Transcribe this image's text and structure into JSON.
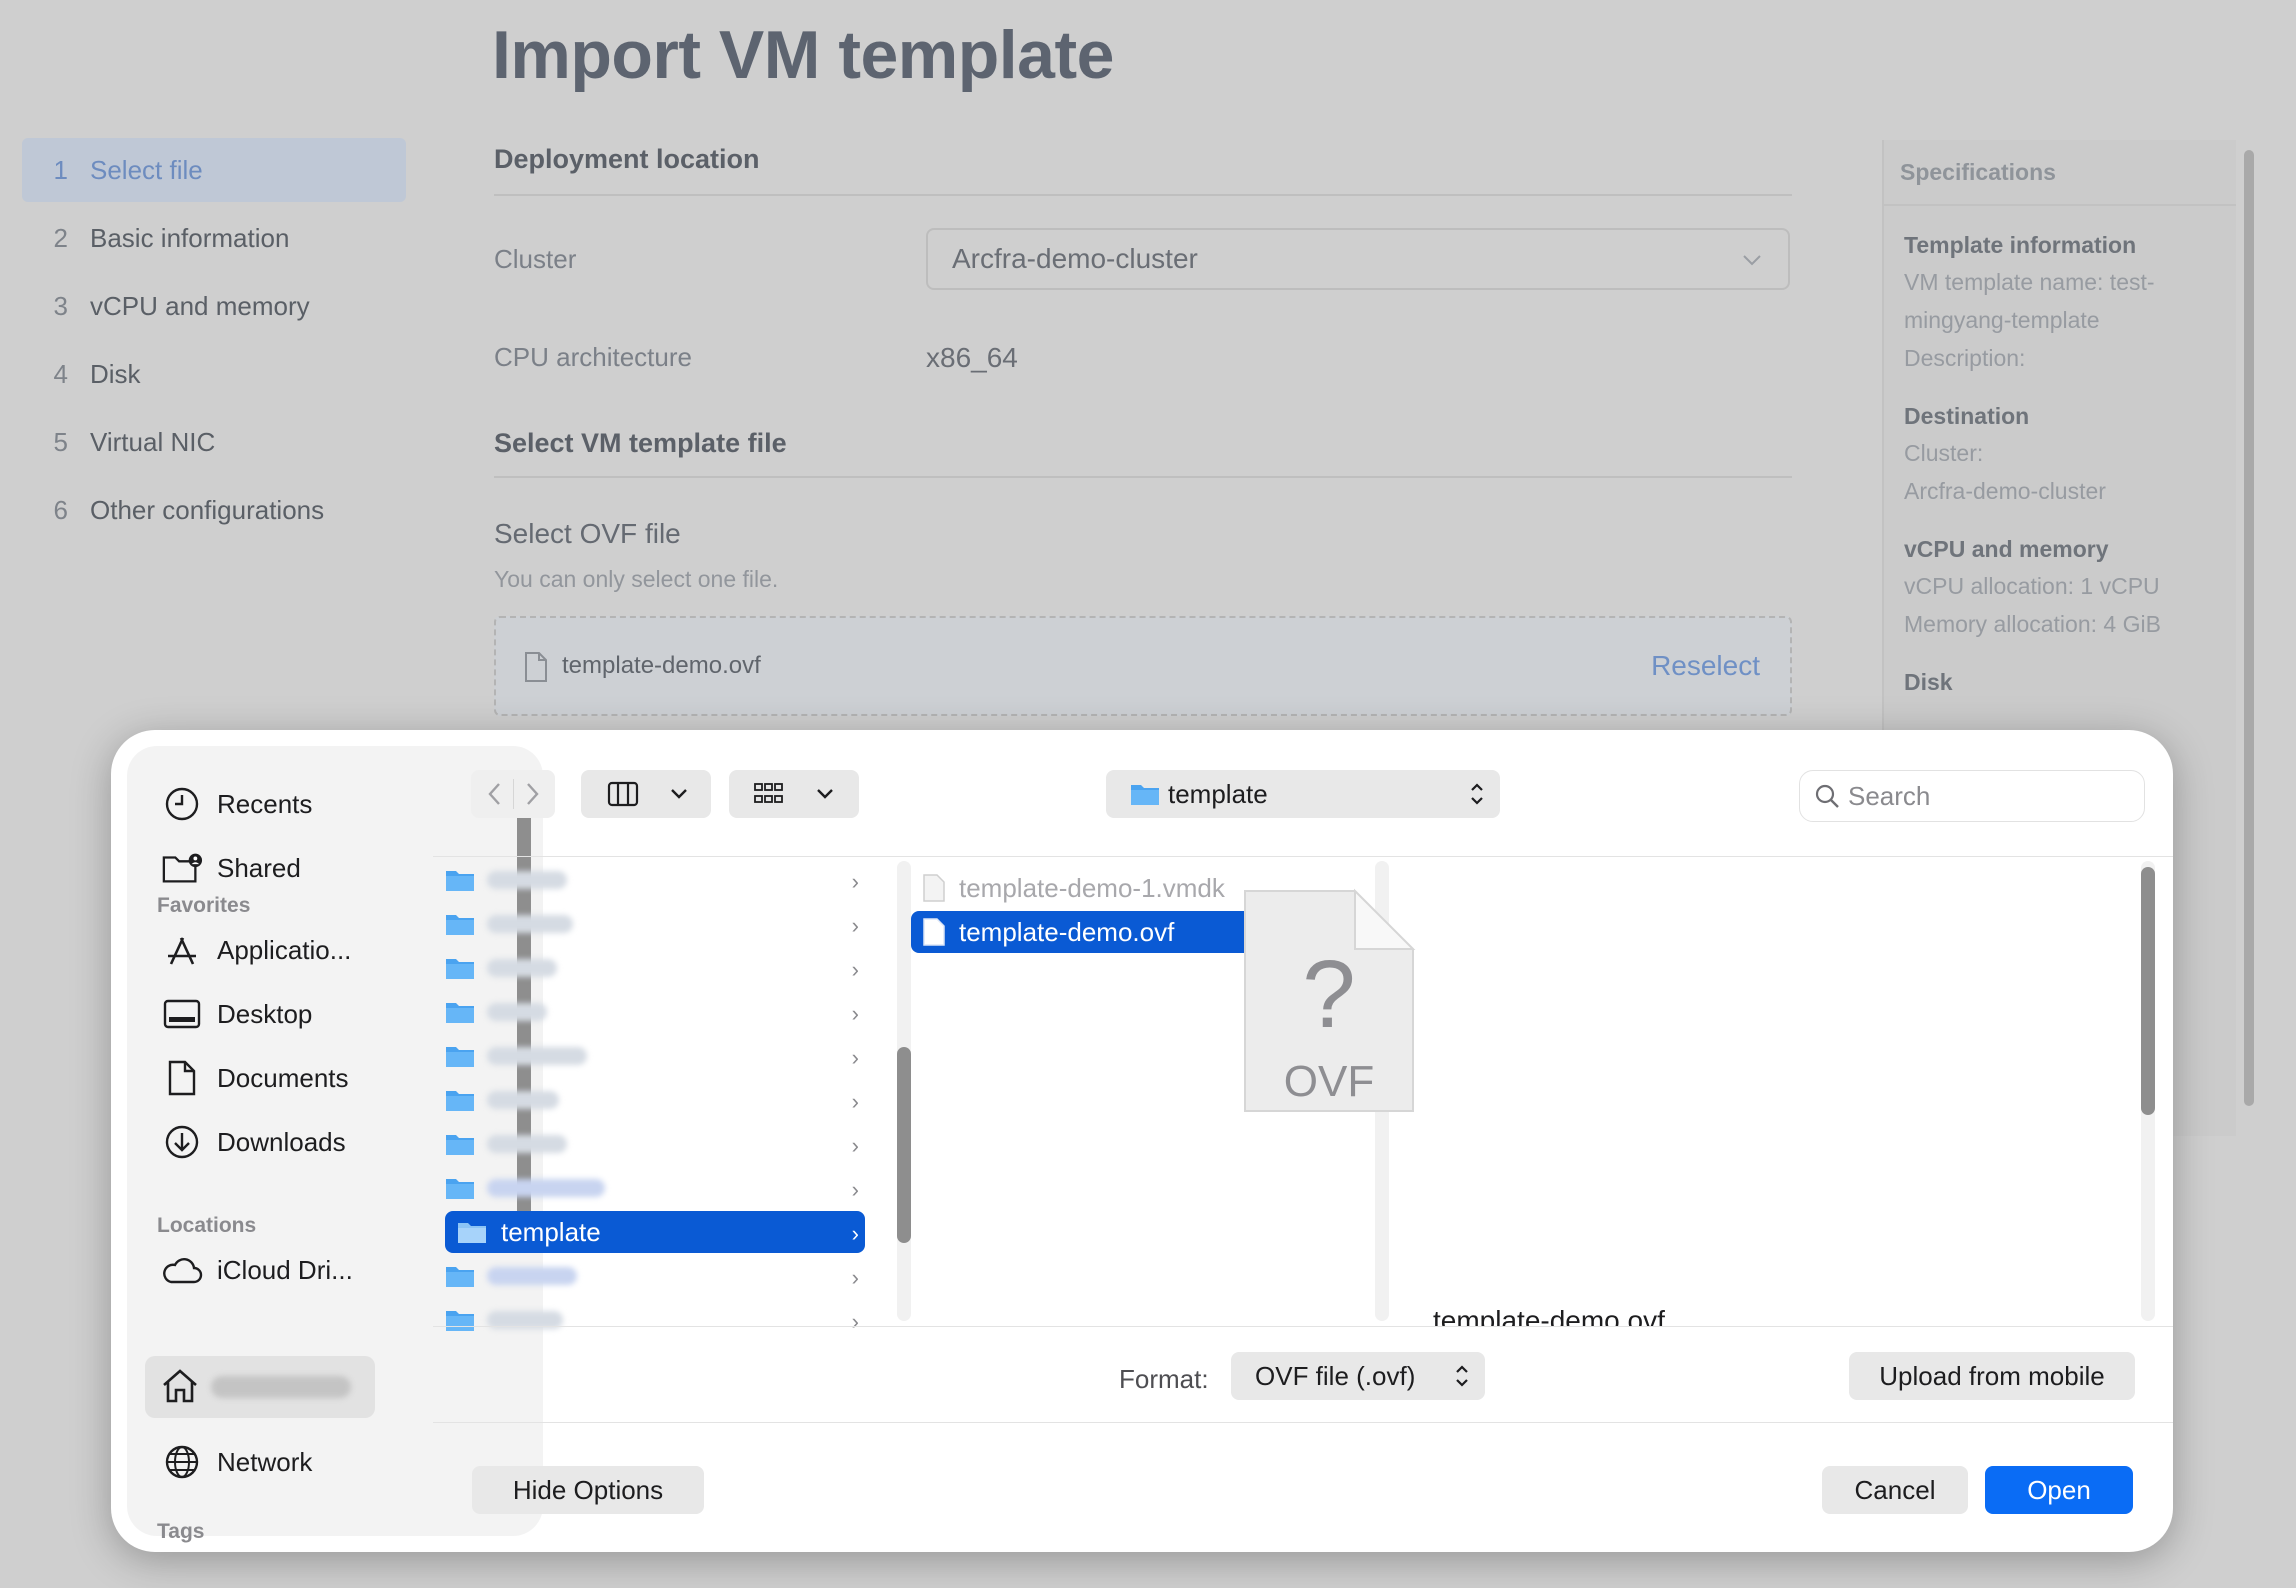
{
  "page": {
    "title": "Import VM template"
  },
  "steps": [
    {
      "num": "1",
      "label": "Select file"
    },
    {
      "num": "2",
      "label": "Basic information"
    },
    {
      "num": "3",
      "label": "vCPU and memory"
    },
    {
      "num": "4",
      "label": "Disk"
    },
    {
      "num": "5",
      "label": "Virtual NIC"
    },
    {
      "num": "6",
      "label": "Other configurations"
    }
  ],
  "deployment": {
    "title": "Deployment location",
    "cluster_label": "Cluster",
    "cluster_value": "Arcfra-demo-cluster",
    "cpu_label": "CPU architecture",
    "cpu_value": "x86_64"
  },
  "select_file": {
    "title": "Select VM template file",
    "ovf_label": "Select OVF file",
    "hint": "You can only select one file.",
    "file_name": "template-demo.ovf",
    "reselect": "Reselect"
  },
  "specs": {
    "title": "Specifications",
    "template_info_h": "Template information",
    "template_name": "VM template name: test-mingyang-template",
    "description": "Description:",
    "destination_h": "Destination",
    "cluster_label": "Cluster:",
    "cluster_value": "Arcfra-demo-cluster",
    "vcpu_h": "vCPU and memory",
    "vcpu_alloc": "vCPU allocation: 1 vCPU",
    "mem_alloc": "Memory allocation: 4 GiB",
    "disk_h": "Disk"
  },
  "dialog": {
    "sidebar": {
      "recents": "Recents",
      "shared": "Shared",
      "favorites_h": "Favorites",
      "applications": "Applicatio...",
      "desktop": "Desktop",
      "documents": "Documents",
      "downloads": "Downloads",
      "locations_h": "Locations",
      "icloud": "iCloud Dri...",
      "network": "Network",
      "tags_h": "Tags"
    },
    "path": "template",
    "search_placeholder": "Search",
    "selected_folder": "template",
    "files": [
      "template-demo-1.vmdk",
      "template-demo.ovf"
    ],
    "preview_name": "template-demo.ovf",
    "preview_ext": "OVF",
    "format_label": "Format:",
    "format_value": "OVF file (.ovf)",
    "upload_mobile": "Upload from mobile",
    "hide_options": "Hide Options",
    "cancel": "Cancel",
    "open": "Open"
  }
}
